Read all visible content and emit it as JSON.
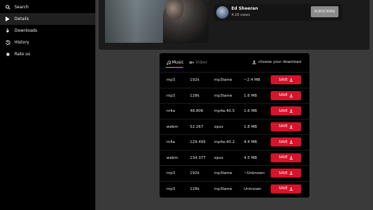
{
  "sidebar": {
    "items": [
      {
        "label": "Search",
        "icon": "search-icon"
      },
      {
        "label": "Details",
        "icon": "play-icon"
      },
      {
        "label": "Downloads",
        "icon": "download-icon"
      },
      {
        "label": "History",
        "icon": "history-icon"
      },
      {
        "label": "Rate us",
        "icon": "star-icon"
      }
    ],
    "active": "Details"
  },
  "video": {
    "channel_name": "Ed Sheeran",
    "views": "4.18 views",
    "subscribe_label": "SUBSCRIBE"
  },
  "download_panel": {
    "tabs": [
      {
        "label": "Music",
        "icon": "music-note-icon",
        "active": true
      },
      {
        "label": "Video",
        "icon": "video-camera-icon",
        "active": false
      }
    ],
    "choose_label": "choose your download",
    "save_label": "SAVE",
    "accent_color": "#d6132a",
    "rows": [
      {
        "format": "mp3",
        "bitrate": "192k",
        "codec": "mp3lame",
        "size": "~2.4 MB"
      },
      {
        "format": "mp3",
        "bitrate": "128k",
        "codec": "mp3lame",
        "size": "1.6 MB"
      },
      {
        "format": "m4a",
        "bitrate": "48.806",
        "codec": "mp4a.40.5",
        "size": "1.6 MB"
      },
      {
        "format": "webm",
        "bitrate": "52.267",
        "codec": "opus",
        "size": "1.8 MB"
      },
      {
        "format": "m4a",
        "bitrate": "129.495",
        "codec": "mp4a.40.2",
        "size": "4.4 MB"
      },
      {
        "format": "webm",
        "bitrate": "134.377",
        "codec": "opus",
        "size": "4.5 MB"
      },
      {
        "format": "mp3",
        "bitrate": "192k",
        "codec": "mp3lame",
        "size": "~Unknown"
      },
      {
        "format": "mp3",
        "bitrate": "128k",
        "codec": "mp3lame",
        "size": "Unknown"
      }
    ]
  }
}
